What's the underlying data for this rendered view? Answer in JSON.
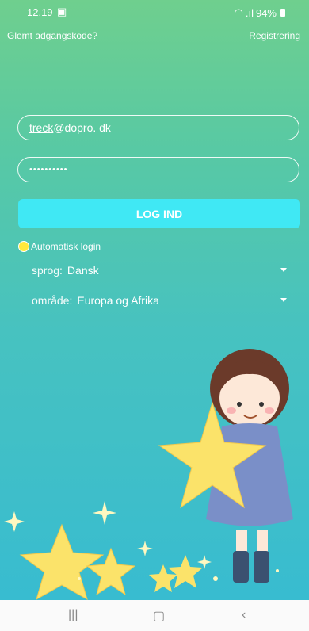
{
  "status": {
    "time": "12.19",
    "battery": "94%"
  },
  "links": {
    "forgot": "Glemt adgangskode?",
    "register": "Registrering"
  },
  "login": {
    "email_user": "treck",
    "email_rest": "@dopro. dk",
    "password_mask": "••••••••••",
    "button": "LOG IND"
  },
  "auto_login": "Automatisk login",
  "language": {
    "label": "sprog:",
    "value": "Dansk"
  },
  "region": {
    "label": "område:",
    "value": "Europa og Afrika"
  },
  "colors": {
    "accent": "#40e8f4",
    "radio": "#ffe93b"
  }
}
